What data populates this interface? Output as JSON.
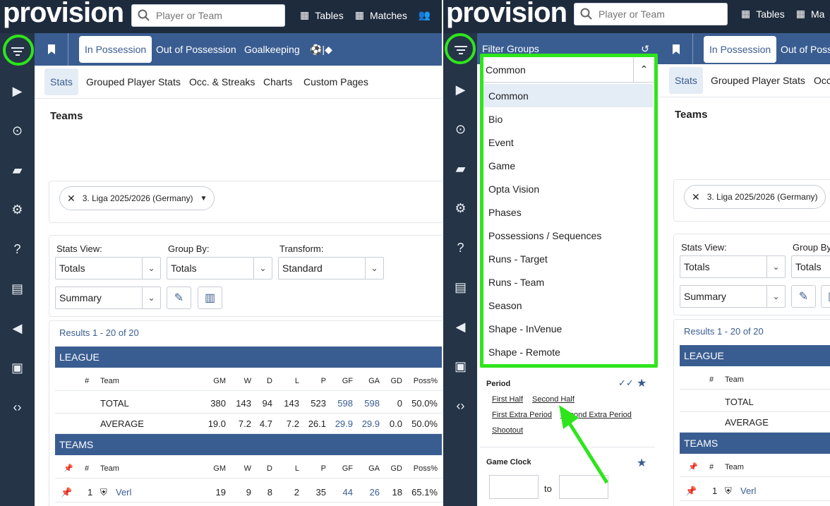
{
  "app": {
    "logo": "provision"
  },
  "search": {
    "placeholder": "Player or Team"
  },
  "nav": {
    "tables": "Tables",
    "matches": "Matches"
  },
  "main_tabs": [
    "In Possession",
    "Out of Possession",
    "Goalkeeping"
  ],
  "main_tabs_right": [
    "In Possession",
    "Out of Poss"
  ],
  "sub_tabs": [
    "Stats",
    "Grouped Player Stats",
    "Occ. & Streaks",
    "Charts",
    "Custom Pages"
  ],
  "sub_tabs_right": [
    "Stats",
    "Grouped Player Stats",
    "Occ"
  ],
  "page": {
    "title": "Teams"
  },
  "competition_chip": "3. Liga 2025/2026 (Germany)",
  "controls": {
    "stats_view_label": "Stats View:",
    "stats_view_value": "Totals",
    "group_by_label": "Group By:",
    "group_by_value": "Totals",
    "group_by_label_right": "Group By",
    "transform_label": "Transform:",
    "transform_value": "Standard",
    "summary_value": "Summary"
  },
  "results_text": "Results 1 - 20 of 20",
  "league": {
    "title": "LEAGUE",
    "columns": [
      "#",
      "Team",
      "GM",
      "W",
      "D",
      "L",
      "P",
      "GF",
      "GA",
      "GD",
      "Poss%"
    ],
    "rows": [
      {
        "team": "TOTAL",
        "GM": "380",
        "W": "143",
        "D": "94",
        "L": "143",
        "P": "523",
        "GF": "598",
        "GA": "598",
        "GD": "0",
        "Poss": "50.0%"
      },
      {
        "team": "AVERAGE",
        "GM": "19.0",
        "W": "7.2",
        "D": "4.7",
        "L": "7.2",
        "P": "26.1",
        "GF": "29.9",
        "GA": "29.9",
        "GD": "0.0",
        "Poss": "50.0%"
      }
    ]
  },
  "teams": {
    "title": "TEAMS",
    "columns": [
      "#",
      "Team",
      "GM",
      "W",
      "D",
      "L",
      "P",
      "GF",
      "GA",
      "GD",
      "Poss%"
    ],
    "rows": [
      {
        "rank": "1",
        "team": "Verl",
        "GM": "19",
        "W": "9",
        "D": "8",
        "L": "2",
        "P": "35",
        "GF": "44",
        "GA": "26",
        "GD": "18",
        "Poss": "65.1%"
      }
    ]
  },
  "filter_groups": {
    "title": "Filter Groups",
    "selected": "Common",
    "options": [
      "Common",
      "Bio",
      "Event",
      "Game",
      "Opta Vision",
      "Phases",
      "Possessions / Sequences",
      "Runs - Target",
      "Runs - Team",
      "Season",
      "Shape - InVenue",
      "Shape - Remote"
    ],
    "period": {
      "title": "Period",
      "options": [
        "First Half",
        "Second Half",
        "First Extra Period",
        "Second Extra Period",
        "Shootout"
      ]
    },
    "game_clock": {
      "title": "Game Clock",
      "to": "to"
    }
  },
  "highlight_color": "#2ee51c",
  "accent_color": "#3a5d91"
}
